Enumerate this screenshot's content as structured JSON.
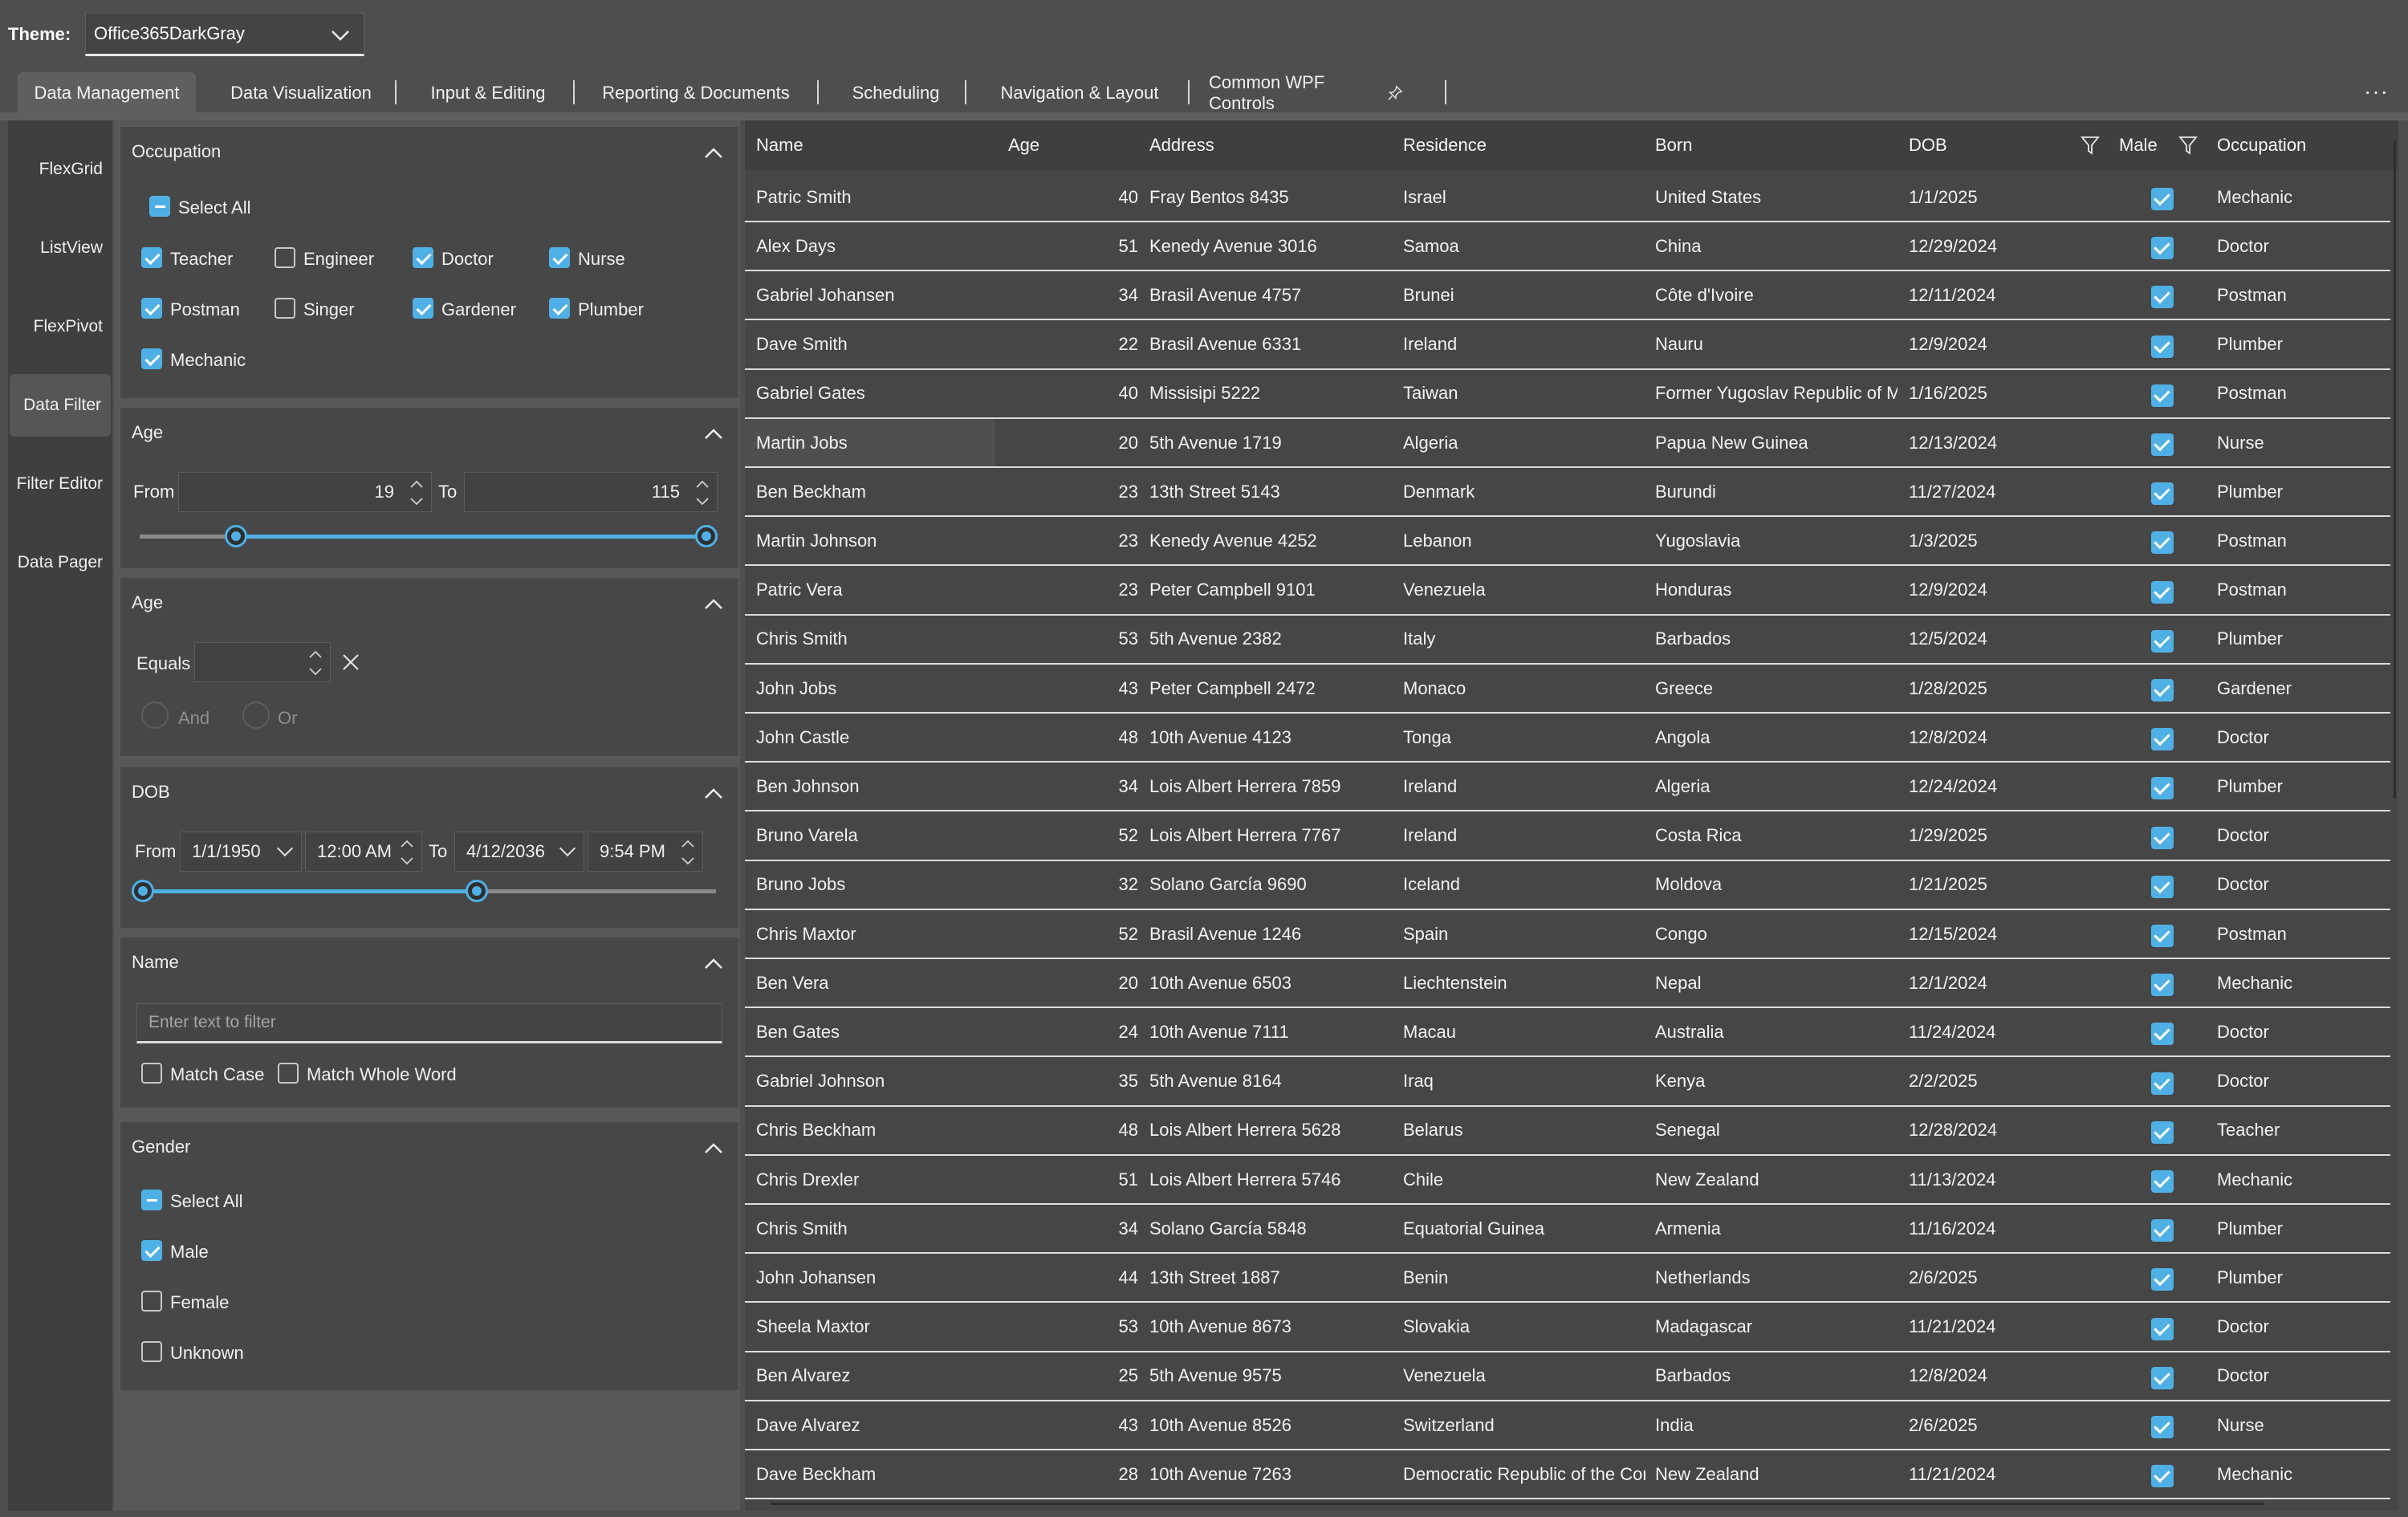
{
  "theme": {
    "label": "Theme:",
    "value": "Office365DarkGray"
  },
  "tabs": [
    {
      "label": "Data Management"
    },
    {
      "label": "Data Visualization"
    },
    {
      "label": "Input & Editing"
    },
    {
      "label": "Reporting & Documents"
    },
    {
      "label": "Scheduling"
    },
    {
      "label": "Navigation & Layout"
    },
    {
      "label": "Common WPF Controls"
    }
  ],
  "more_label": "···",
  "nav": [
    {
      "label": "FlexGrid"
    },
    {
      "label": "ListView"
    },
    {
      "label": "FlexPivot"
    },
    {
      "label": "Data Filter"
    },
    {
      "label": "Filter Editor"
    },
    {
      "label": "Data Pager"
    }
  ],
  "filters": {
    "occupation": {
      "title": "Occupation",
      "select_all": "Select All",
      "options": [
        {
          "label": "Teacher",
          "checked": true
        },
        {
          "label": "Engineer",
          "checked": false
        },
        {
          "label": "Doctor",
          "checked": true
        },
        {
          "label": "Nurse",
          "checked": true
        },
        {
          "label": "Postman",
          "checked": true
        },
        {
          "label": "Singer",
          "checked": false
        },
        {
          "label": "Gardener",
          "checked": true
        },
        {
          "label": "Plumber",
          "checked": true
        },
        {
          "label": "Mechanic",
          "checked": true
        }
      ]
    },
    "age_range": {
      "title": "Age",
      "from_label": "From",
      "from_value": "19",
      "to_label": "To",
      "to_value": "115",
      "range": [
        19,
        115
      ]
    },
    "age_equals": {
      "title": "Age",
      "equals_label": "Equals",
      "and_label": "And",
      "or_label": "Or"
    },
    "dob": {
      "title": "DOB",
      "from_label": "From",
      "from_date": "1/1/1950",
      "from_time": "12:00 AM",
      "to_label": "To",
      "to_date": "4/12/2036",
      "to_time": "9:54 PM"
    },
    "name": {
      "title": "Name",
      "placeholder": "Enter text to filter",
      "match_case": "Match Case",
      "match_whole_word": "Match Whole Word"
    },
    "gender": {
      "title": "Gender",
      "select_all": "Select All",
      "options": [
        {
          "label": "Male",
          "checked": true
        },
        {
          "label": "Female",
          "checked": false
        },
        {
          "label": "Unknown",
          "checked": false
        }
      ]
    }
  },
  "grid": {
    "columns": [
      "Name",
      "Age",
      "Address",
      "Residence",
      "Born",
      "DOB",
      "Male",
      "Occupation"
    ],
    "rows": [
      [
        "Patric Smith",
        "40",
        "Fray Bentos 8435",
        "Israel",
        "United States",
        "1/1/2025",
        true,
        "Mechanic"
      ],
      [
        "Alex Days",
        "51",
        "Kenedy Avenue 3016",
        "Samoa",
        "China",
        "12/29/2024",
        true,
        "Doctor"
      ],
      [
        "Gabriel Johansen",
        "34",
        "Brasil Avenue 4757",
        "Brunei",
        "Côte d'Ivoire",
        "12/11/2024",
        true,
        "Postman"
      ],
      [
        "Dave Smith",
        "22",
        "Brasil Avenue 6331",
        "Ireland",
        "Nauru",
        "12/9/2024",
        true,
        "Plumber"
      ],
      [
        "Gabriel Gates",
        "40",
        "Missisipi 5222",
        "Taiwan",
        "Former Yugoslav Republic of M",
        "1/16/2025",
        true,
        "Postman"
      ],
      [
        "Martin Jobs",
        "20",
        "5th Avenue 1719",
        "Algeria",
        "Papua New Guinea",
        "12/13/2024",
        true,
        "Nurse"
      ],
      [
        "Ben Beckham",
        "23",
        "13th Street 5143",
        "Denmark",
        "Burundi",
        "11/27/2024",
        true,
        "Plumber"
      ],
      [
        "Martin Johnson",
        "23",
        "Kenedy Avenue 4252",
        "Lebanon",
        "Yugoslavia",
        "1/3/2025",
        true,
        "Postman"
      ],
      [
        "Patric Vera",
        "23",
        "Peter Campbell 9101",
        "Venezuela",
        "Honduras",
        "12/9/2024",
        true,
        "Postman"
      ],
      [
        "Chris Smith",
        "53",
        "5th Avenue 2382",
        "Italy",
        "Barbados",
        "12/5/2024",
        true,
        "Plumber"
      ],
      [
        "John Jobs",
        "43",
        "Peter Campbell 2472",
        "Monaco",
        "Greece",
        "1/28/2025",
        true,
        "Gardener"
      ],
      [
        "John Castle",
        "48",
        "10th Avenue 4123",
        "Tonga",
        "Angola",
        "12/8/2024",
        true,
        "Doctor"
      ],
      [
        "Ben Johnson",
        "34",
        "Lois Albert Herrera 7859",
        "Ireland",
        "Algeria",
        "12/24/2024",
        true,
        "Plumber"
      ],
      [
        "Bruno Varela",
        "52",
        "Lois Albert Herrera 7767",
        "Ireland",
        "Costa Rica",
        "1/29/2025",
        true,
        "Doctor"
      ],
      [
        "Bruno Jobs",
        "32",
        "Solano García 9690",
        "Iceland",
        "Moldova",
        "1/21/2025",
        true,
        "Doctor"
      ],
      [
        "Chris Maxtor",
        "52",
        "Brasil Avenue 1246",
        "Spain",
        "Congo",
        "12/15/2024",
        true,
        "Postman"
      ],
      [
        "Ben Vera",
        "20",
        "10th Avenue 6503",
        "Liechtenstein",
        "Nepal",
        "12/1/2024",
        true,
        "Mechanic"
      ],
      [
        "Ben Gates",
        "24",
        "10th Avenue 7111",
        "Macau",
        "Australia",
        "11/24/2024",
        true,
        "Doctor"
      ],
      [
        "Gabriel Johnson",
        "35",
        "5th Avenue 8164",
        "Iraq",
        "Kenya",
        "2/2/2025",
        true,
        "Doctor"
      ],
      [
        "Chris Beckham",
        "48",
        "Lois Albert Herrera 5628",
        "Belarus",
        "Senegal",
        "12/28/2024",
        true,
        "Teacher"
      ],
      [
        "Chris Drexler",
        "51",
        "Lois Albert Herrera 5746",
        "Chile",
        "New Zealand",
        "11/13/2024",
        true,
        "Mechanic"
      ],
      [
        "Chris Smith",
        "34",
        "Solano García 5848",
        "Equatorial Guinea",
        "Armenia",
        "11/16/2024",
        true,
        "Plumber"
      ],
      [
        "John Johansen",
        "44",
        "13th Street 1887",
        "Benin",
        "Netherlands",
        "2/6/2025",
        true,
        "Plumber"
      ],
      [
        "Sheela Maxtor",
        "53",
        "10th Avenue 8673",
        "Slovakia",
        "Madagascar",
        "11/21/2024",
        true,
        "Doctor"
      ],
      [
        "Ben Alvarez",
        "25",
        "5th Avenue 9575",
        "Venezuela",
        "Barbados",
        "12/8/2024",
        true,
        "Doctor"
      ],
      [
        "Dave Alvarez",
        "43",
        "10th Avenue 8526",
        "Switzerland",
        "India",
        "2/6/2025",
        true,
        "Nurse"
      ],
      [
        "Dave Beckham",
        "28",
        "10th Avenue 7263",
        "Democratic Republic of the Cor",
        "New Zealand",
        "11/21/2024",
        true,
        "Mechanic"
      ]
    ]
  },
  "colors": {
    "accent": "#4fb0e6",
    "background": "#4e4e4e",
    "panel": "#474747"
  }
}
